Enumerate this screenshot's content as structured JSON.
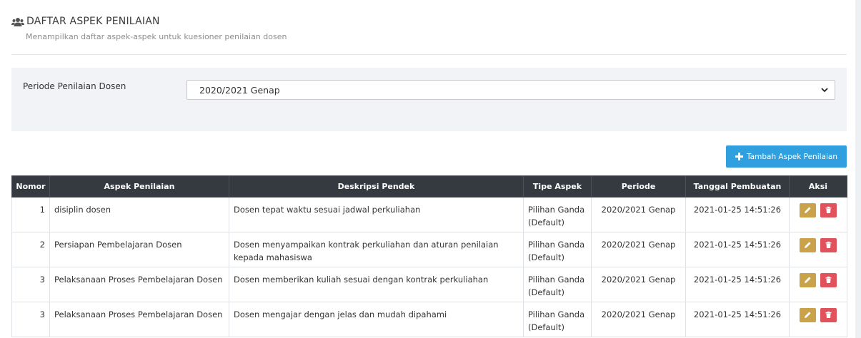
{
  "header": {
    "title": "DAFTAR ASPEK PENILAIAN",
    "subtitle": "Menampilkan daftar aspek-aspek untuk kuesioner penilaian dosen",
    "icon": "users-icon"
  },
  "filter": {
    "label": "Periode Penilaian Dosen",
    "selected": "2020/2021 Genap"
  },
  "toolbar": {
    "add_label": "Tambah Aspek Penilaian"
  },
  "table": {
    "columns": [
      "Nomor",
      "Aspek Penilaian",
      "Deskripsi Pendek",
      "Tipe Aspek",
      "Periode",
      "Tanggal Pembuatan",
      "Aksi"
    ],
    "rows": [
      {
        "nomor": "1",
        "aspek": "disiplin dosen",
        "deskripsi": "Dosen tepat waktu sesuai jadwal perkuliahan",
        "tipe": "Pilihan Ganda (Default)",
        "periode": "2020/2021 Genap",
        "tanggal": "2021-01-25 14:51:26"
      },
      {
        "nomor": "2",
        "aspek": "Persiapan Pembelajaran Dosen",
        "deskripsi": "Dosen menyampaikan kontrak perkuliahan dan aturan penilaian kepada mahasiswa",
        "tipe": "Pilihan Ganda (Default)",
        "periode": "2020/2021 Genap",
        "tanggal": "2021-01-25 14:51:26"
      },
      {
        "nomor": "3",
        "aspek": "Pelaksanaan Proses Pembelajaran Dosen",
        "deskripsi": "Dosen memberikan kuliah sesuai dengan kontrak perkuliahan",
        "tipe": "Pilihan Ganda (Default)",
        "periode": "2020/2021 Genap",
        "tanggal": "2021-01-25 14:51:26"
      },
      {
        "nomor": "3",
        "aspek": "Pelaksanaan Proses Pembelajaran Dosen",
        "deskripsi": "Dosen mengajar dengan jelas dan mudah dipahami",
        "tipe": "Pilihan Ganda (Default)",
        "periode": "2020/2021 Genap",
        "tanggal": "2021-01-25 14:51:26"
      }
    ]
  },
  "colors": {
    "accent": "#2f9fe0",
    "header_bg": "#343a40",
    "edit": "#c9a24a",
    "delete": "#e2525c",
    "panel_bg": "#f1f3f6"
  }
}
